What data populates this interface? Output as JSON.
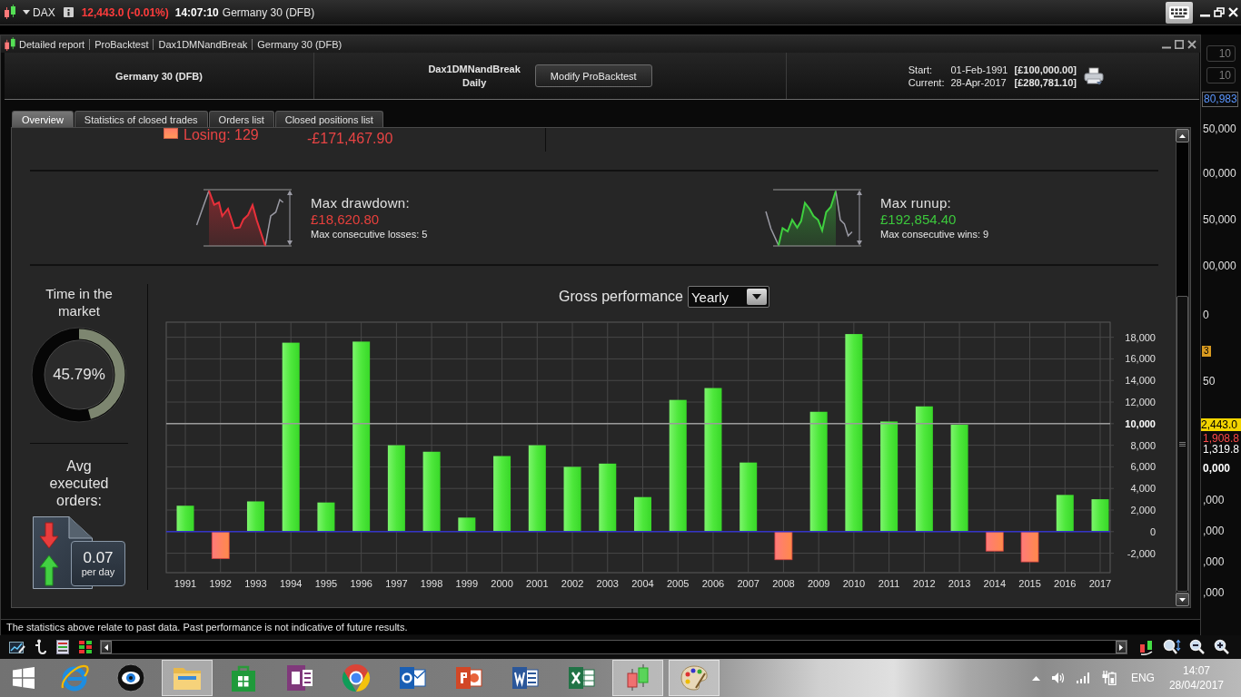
{
  "top_bar": {
    "symbol": "DAX",
    "quote": "12,443.0 (-0.01%)",
    "time": "14:07:10",
    "instrument": "Germany 30 (DFB)"
  },
  "window": {
    "breadcrumbs": [
      "Detailed report",
      "ProBacktest",
      "Dax1DMNandBreak",
      "Germany 30 (DFB)"
    ]
  },
  "header": {
    "instrument": "Germany 30 (DFB)",
    "system": "Dax1DMNandBreak",
    "period": "Daily",
    "button": "Modify ProBacktest",
    "capital_rows": [
      {
        "label": "Start:",
        "date": "01-Feb-1991",
        "amount": "[£100,000.00]"
      },
      {
        "label": "Current:",
        "date": "28-Apr-2017",
        "amount": "[£280,781.10]"
      }
    ]
  },
  "tabs": [
    {
      "label": "Overview",
      "selected": true
    },
    {
      "label": "Statistics of closed trades",
      "selected": false
    },
    {
      "label": "Orders list",
      "selected": false
    },
    {
      "label": "Closed positions list",
      "selected": false
    }
  ],
  "overview": {
    "losing": {
      "label": "Losing: 129",
      "amount": "-£171,467.90"
    },
    "extremes": [
      {
        "kind": "drawdown",
        "title": "Max drawdown:",
        "amount": "£18,620.80",
        "detail": "Max consecutive losses: 5"
      },
      {
        "kind": "runup",
        "title": "Max runup:",
        "amount": "£192,854.40",
        "detail": "Max consecutive wins: 9"
      }
    ],
    "time_in_market": {
      "title": "Time in the market",
      "value": "45.79%",
      "level": 0.4579
    },
    "avg_orders": {
      "title": "Avg executed orders:",
      "value": "0.07",
      "unit": "per day"
    },
    "performance": {
      "period": "Yearly",
      "chart_data": {
        "type": "bar",
        "title": "Gross performance",
        "categories": [
          "1991",
          "1992",
          "1993",
          "1994",
          "1995",
          "1996",
          "1997",
          "1998",
          "1999",
          "2000",
          "2001",
          "2002",
          "2003",
          "2004",
          "2005",
          "2006",
          "2007",
          "2008",
          "2009",
          "2010",
          "2011",
          "2012",
          "2013",
          "2014",
          "2015",
          "2016",
          "2017"
        ],
        "values": [
          2400,
          -2500,
          2800,
          17500,
          2700,
          17600,
          8000,
          7400,
          1300,
          7000,
          8000,
          6000,
          6300,
          3200,
          12200,
          13300,
          6400,
          -2600,
          11100,
          18300,
          10200,
          11600,
          9900,
          -1800,
          -2800,
          3400,
          3000
        ],
        "ylim": [
          -3800,
          19400
        ],
        "yticks": [
          {
            "value": -2000,
            "label": "-2,000"
          },
          {
            "value": 0,
            "label": "0"
          },
          {
            "value": 2000,
            "label": "2,000"
          },
          {
            "value": 4000,
            "label": "4,000"
          },
          {
            "value": 6000,
            "label": "6,000"
          },
          {
            "value": 8000,
            "label": "8,000"
          },
          {
            "value": 10000,
            "label": "10,000"
          },
          {
            "value": 12000,
            "label": "12,000"
          },
          {
            "value": 14000,
            "label": "14,000"
          },
          {
            "value": 16000,
            "label": "16,000"
          },
          {
            "value": 18000,
            "label": "18,000"
          }
        ],
        "grid": true,
        "ref_lines": [
          {
            "axis": "y",
            "value": 0,
            "color": "#3434c8"
          },
          {
            "axis": "y",
            "value": 10000,
            "color": "#9a9a9a"
          }
        ]
      }
    }
  },
  "disclaimer": "The statistics above relate to past data. Past performance is not indicative of future results.",
  "background_chart": {
    "labels": [
      {
        "text": "10",
        "kind": "field"
      },
      {
        "text": "10",
        "kind": "field"
      },
      {
        "text": "80,983",
        "kind": "price"
      },
      {
        "text": "50,000",
        "kind": "axis"
      },
      {
        "text": "00,000",
        "kind": "axis"
      },
      {
        "text": "50,000",
        "kind": "axis"
      },
      {
        "text": "00,000",
        "kind": "axis"
      },
      {
        "text": "0",
        "kind": "axis"
      },
      {
        "text": "3",
        "kind": "marker"
      },
      {
        "text": "50",
        "kind": "axis"
      },
      {
        "text": "2,443.0",
        "kind": "last-price"
      },
      {
        "text": "1,908.8",
        "kind": "loss"
      },
      {
        "text": "1,319.8",
        "kind": "level"
      },
      {
        "text": "0,000",
        "kind": "axis-bold"
      },
      {
        "text": ",000",
        "kind": "axis"
      },
      {
        "text": ",000",
        "kind": "axis"
      },
      {
        "text": ",000",
        "kind": "axis"
      },
      {
        "text": ",000",
        "kind": "axis"
      }
    ]
  },
  "taskbar": {
    "apps": [
      {
        "kind": "ie",
        "highlighted": false
      },
      {
        "kind": "eye",
        "highlighted": false
      },
      {
        "kind": "folder",
        "highlighted": true
      },
      {
        "kind": "store",
        "highlighted": false
      },
      {
        "kind": "onenote",
        "highlighted": false
      },
      {
        "kind": "chrome",
        "highlighted": false
      },
      {
        "kind": "outlook",
        "highlighted": false
      },
      {
        "kind": "powerpoint",
        "highlighted": false
      },
      {
        "kind": "word",
        "highlighted": false
      },
      {
        "kind": "excel",
        "highlighted": false
      },
      {
        "kind": "candles",
        "highlighted": true
      },
      {
        "kind": "palette",
        "highlighted": true
      }
    ],
    "language": "ENG",
    "time": "14:07",
    "date": "28/04/2017"
  }
}
